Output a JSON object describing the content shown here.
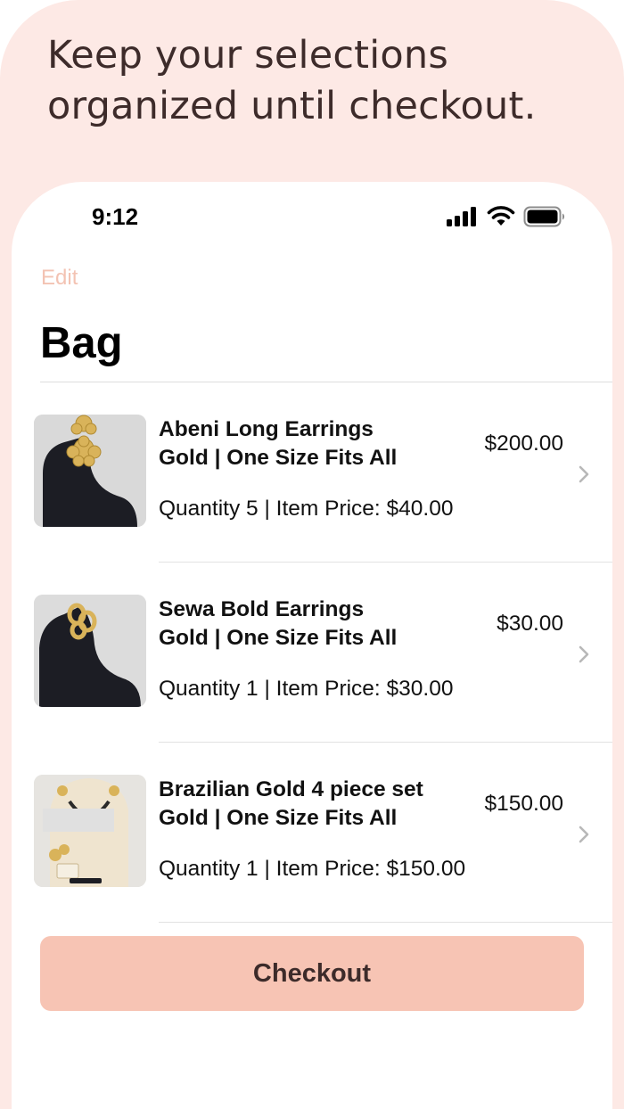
{
  "headline": {
    "line1": "Keep your selections",
    "line2": "organized until checkout."
  },
  "status_bar": {
    "time": "9:12",
    "icons": [
      "cellular-signal-icon",
      "wifi-icon",
      "battery-icon"
    ]
  },
  "nav": {
    "edit_label": "Edit",
    "title": "Bag"
  },
  "items": [
    {
      "name": "Abeni Long Earrings",
      "variant": "Gold | One Size Fits All",
      "quantity_line": "Quantity 5 | Item Price: $40.00",
      "total": "$200.00"
    },
    {
      "name": "Sewa Bold Earrings",
      "variant": "Gold | One Size Fits All",
      "quantity_line": "Quantity 1 | Item Price: $30.00",
      "total": "$30.00"
    },
    {
      "name": "Brazilian Gold 4 piece set",
      "variant": "Gold | One Size Fits All",
      "quantity_line": "Quantity 1 | Item Price: $150.00",
      "total": "$150.00"
    }
  ],
  "checkout": {
    "label": "Checkout"
  },
  "colors": {
    "background_tint": "#fde9e5",
    "accent_button": "#f7c4b4",
    "edit_link": "#f3c3b3",
    "headline_text": "#3d2b2a"
  }
}
